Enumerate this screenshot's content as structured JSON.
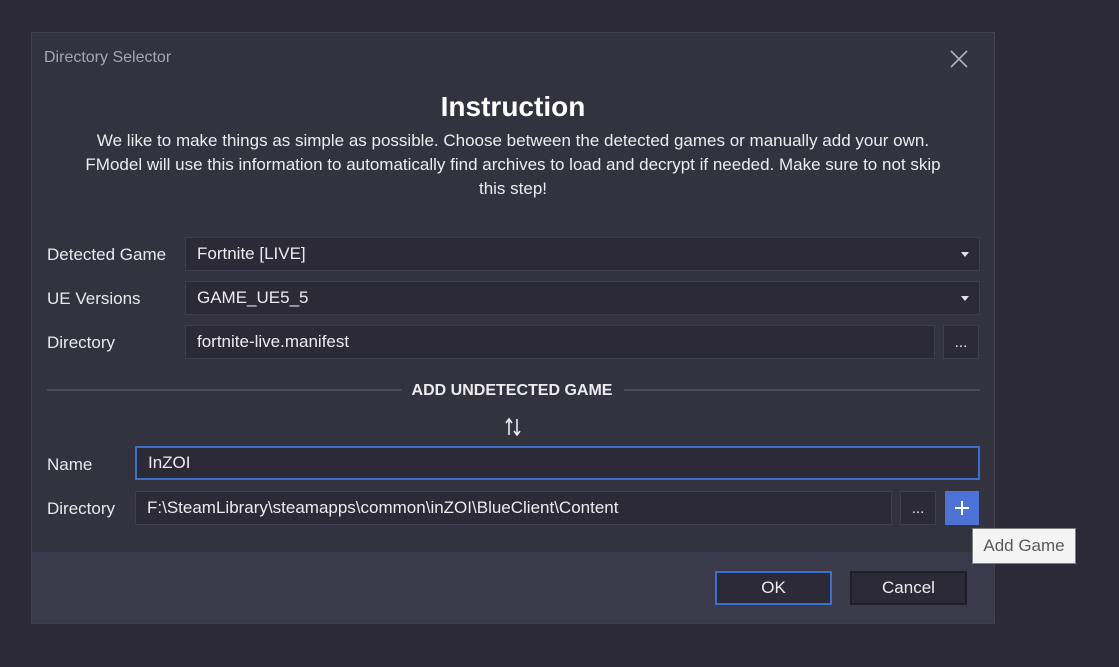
{
  "window": {
    "title": "Directory Selector"
  },
  "instruction": {
    "heading": "Instruction",
    "line1": "We like to make things as simple as possible. Choose between the detected games or manually add your own.",
    "line2": "FModel will use this information to automatically find archives to load and decrypt if needed. Make sure to not skip",
    "line3": "this step!"
  },
  "detected": {
    "game_label": "Detected Game",
    "game_value": "Fortnite [LIVE]",
    "ue_label": "UE Versions",
    "ue_value": "GAME_UE5_5",
    "dir_label": "Directory",
    "dir_value": "fortnite-live.manifest",
    "browse_label": "..."
  },
  "undetected": {
    "section_title": "ADD UNDETECTED GAME",
    "name_label": "Name",
    "name_value": "InZOI",
    "dir_label": "Directory",
    "dir_value": "F:\\SteamLibrary\\steamapps\\common\\inZOI\\BlueClient\\Content",
    "browse_label": "...",
    "add_tooltip": "Add Game"
  },
  "buttons": {
    "ok": "OK",
    "cancel": "Cancel"
  },
  "colors": {
    "accent": "#4d73d6",
    "focus_border": "#3b6fc8",
    "background": "#2b2a36",
    "dialog": "#33323f"
  }
}
